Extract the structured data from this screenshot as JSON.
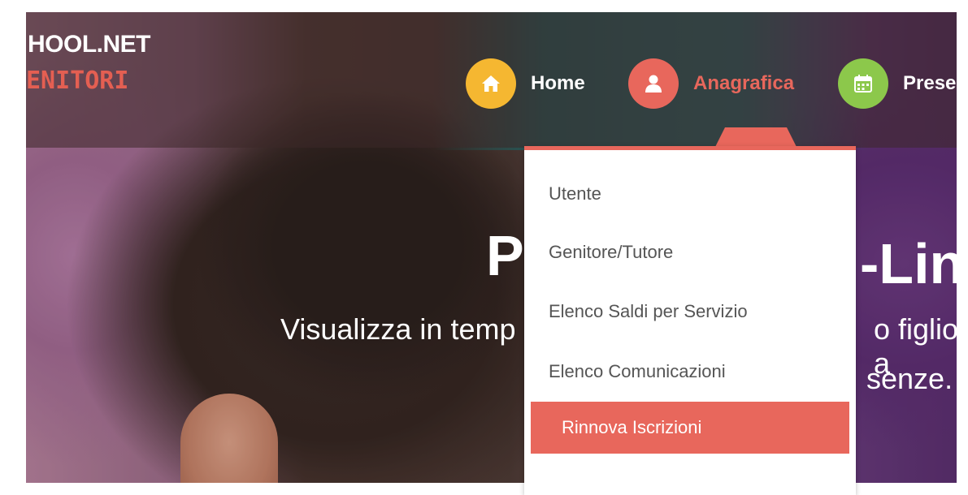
{
  "brand": {
    "line1": "HOOL.NET",
    "line2": "ENITORI",
    "accent_color": "#e45f52"
  },
  "nav": {
    "items": [
      {
        "label": "Home",
        "icon": "home-icon",
        "icon_color": "#f5b731",
        "active": false
      },
      {
        "label": "Anagrafica",
        "icon": "user-icon",
        "icon_color": "#e8675c",
        "active": true
      },
      {
        "label": "Prese",
        "icon": "calendar-icon",
        "icon_color": "#8cc84b",
        "active": false
      }
    ]
  },
  "hero": {
    "title_left": "P",
    "title_right": "-Lin",
    "subtitle_line1_left": "Visualizza in temp",
    "subtitle_line1_right": "o figlio a",
    "subtitle_line2_right": "senze."
  },
  "dropdown": {
    "accent_color": "#e8675c",
    "items": [
      {
        "label": "Utente",
        "active": false
      },
      {
        "label": "Genitore/Tutore",
        "active": false
      },
      {
        "label": "Elenco Saldi per Servizio",
        "active": false
      },
      {
        "label": "Elenco Comunicazioni",
        "active": false
      },
      {
        "label": "Rinnova Iscrizioni",
        "active": true
      }
    ]
  }
}
